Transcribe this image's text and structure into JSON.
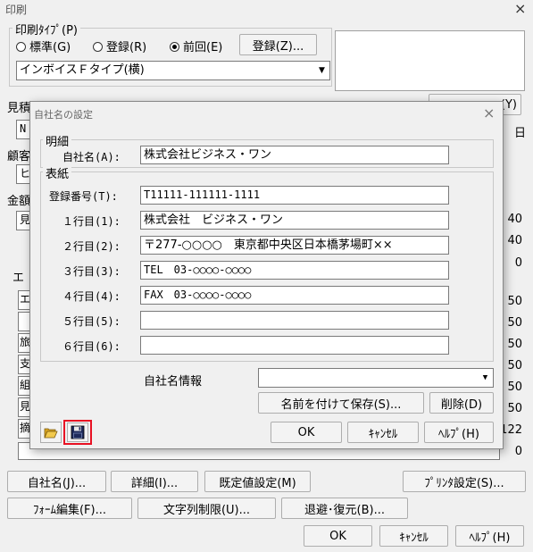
{
  "window": {
    "title": "印刷",
    "close": "×"
  },
  "print_type": {
    "legend": "印刷ﾀｲﾌﾟ(P)",
    "radios": [
      {
        "label": "標準(G)",
        "checked": false
      },
      {
        "label": "登録(R)",
        "checked": false
      },
      {
        "label": "前回(E)",
        "checked": true
      }
    ],
    "register_button": "登録(Z)...",
    "template_value": "インボイスＦタイプ(横)"
  },
  "background_peek": {
    "estimate_label": "見積",
    "row_n": "N",
    "customer_label": "顧客",
    "row_hi": "ヒ",
    "amount_label": "金額",
    "row_mi": "見",
    "group_e": "エ",
    "day_char": "日",
    "button_y": "(Y)",
    "side_values": [
      "40",
      "40",
      "0",
      "50",
      "50",
      "50",
      "50",
      "50",
      "50",
      "122",
      "0"
    ],
    "left_chars": [
      "エ",
      "",
      "旅",
      "支",
      "組",
      "見",
      "摘"
    ]
  },
  "bottom_buttons": {
    "company": "自社名(J)...",
    "detail": "詳細(I)...",
    "defaults": "既定値設定(M)",
    "printer": "ﾌﾟﾘﾝﾀ設定(S)...",
    "form_edit": "ﾌｫｰﾑ編集(F)...",
    "string_limit": "文字列制限(U)...",
    "backup": "退避･復元(B)...",
    "ok": "OK",
    "cancel": "ｷｬﾝｾﾙ",
    "help": "ﾍﾙﾌﾟ(H)"
  },
  "dialog": {
    "title": "自社名の設定",
    "close": "×",
    "detail_legend": "明細",
    "company_label": "自社名(A):",
    "company_value": "株式会社ビジネス・ワン",
    "cover_legend": "表紙",
    "rows": [
      {
        "label": "登録番号(T):",
        "value": "T11111-111111-1111"
      },
      {
        "label": "１行目(1):",
        "value": "株式会社　ビジネス・ワン"
      },
      {
        "label": "２行目(2):",
        "value": "〒277-○○○○　東京都中央区日本橋茅場町××"
      },
      {
        "label": "３行目(3):",
        "value": "TEL　03-○○○○-○○○○"
      },
      {
        "label": "４行目(4):",
        "value": "FAX　03-○○○○-○○○○"
      },
      {
        "label": "５行目(5):",
        "value": ""
      },
      {
        "label": "６行目(6):",
        "value": ""
      }
    ],
    "info_label": "自社名情報",
    "info_value": "",
    "save_as_button": "名前を付けて保存(S)...",
    "delete_button": "削除(D)",
    "ok": "OK",
    "cancel": "ｷｬﾝｾﾙ",
    "help": "ﾍﾙﾌﾟ(H)",
    "highlight_color": "#e81123"
  }
}
